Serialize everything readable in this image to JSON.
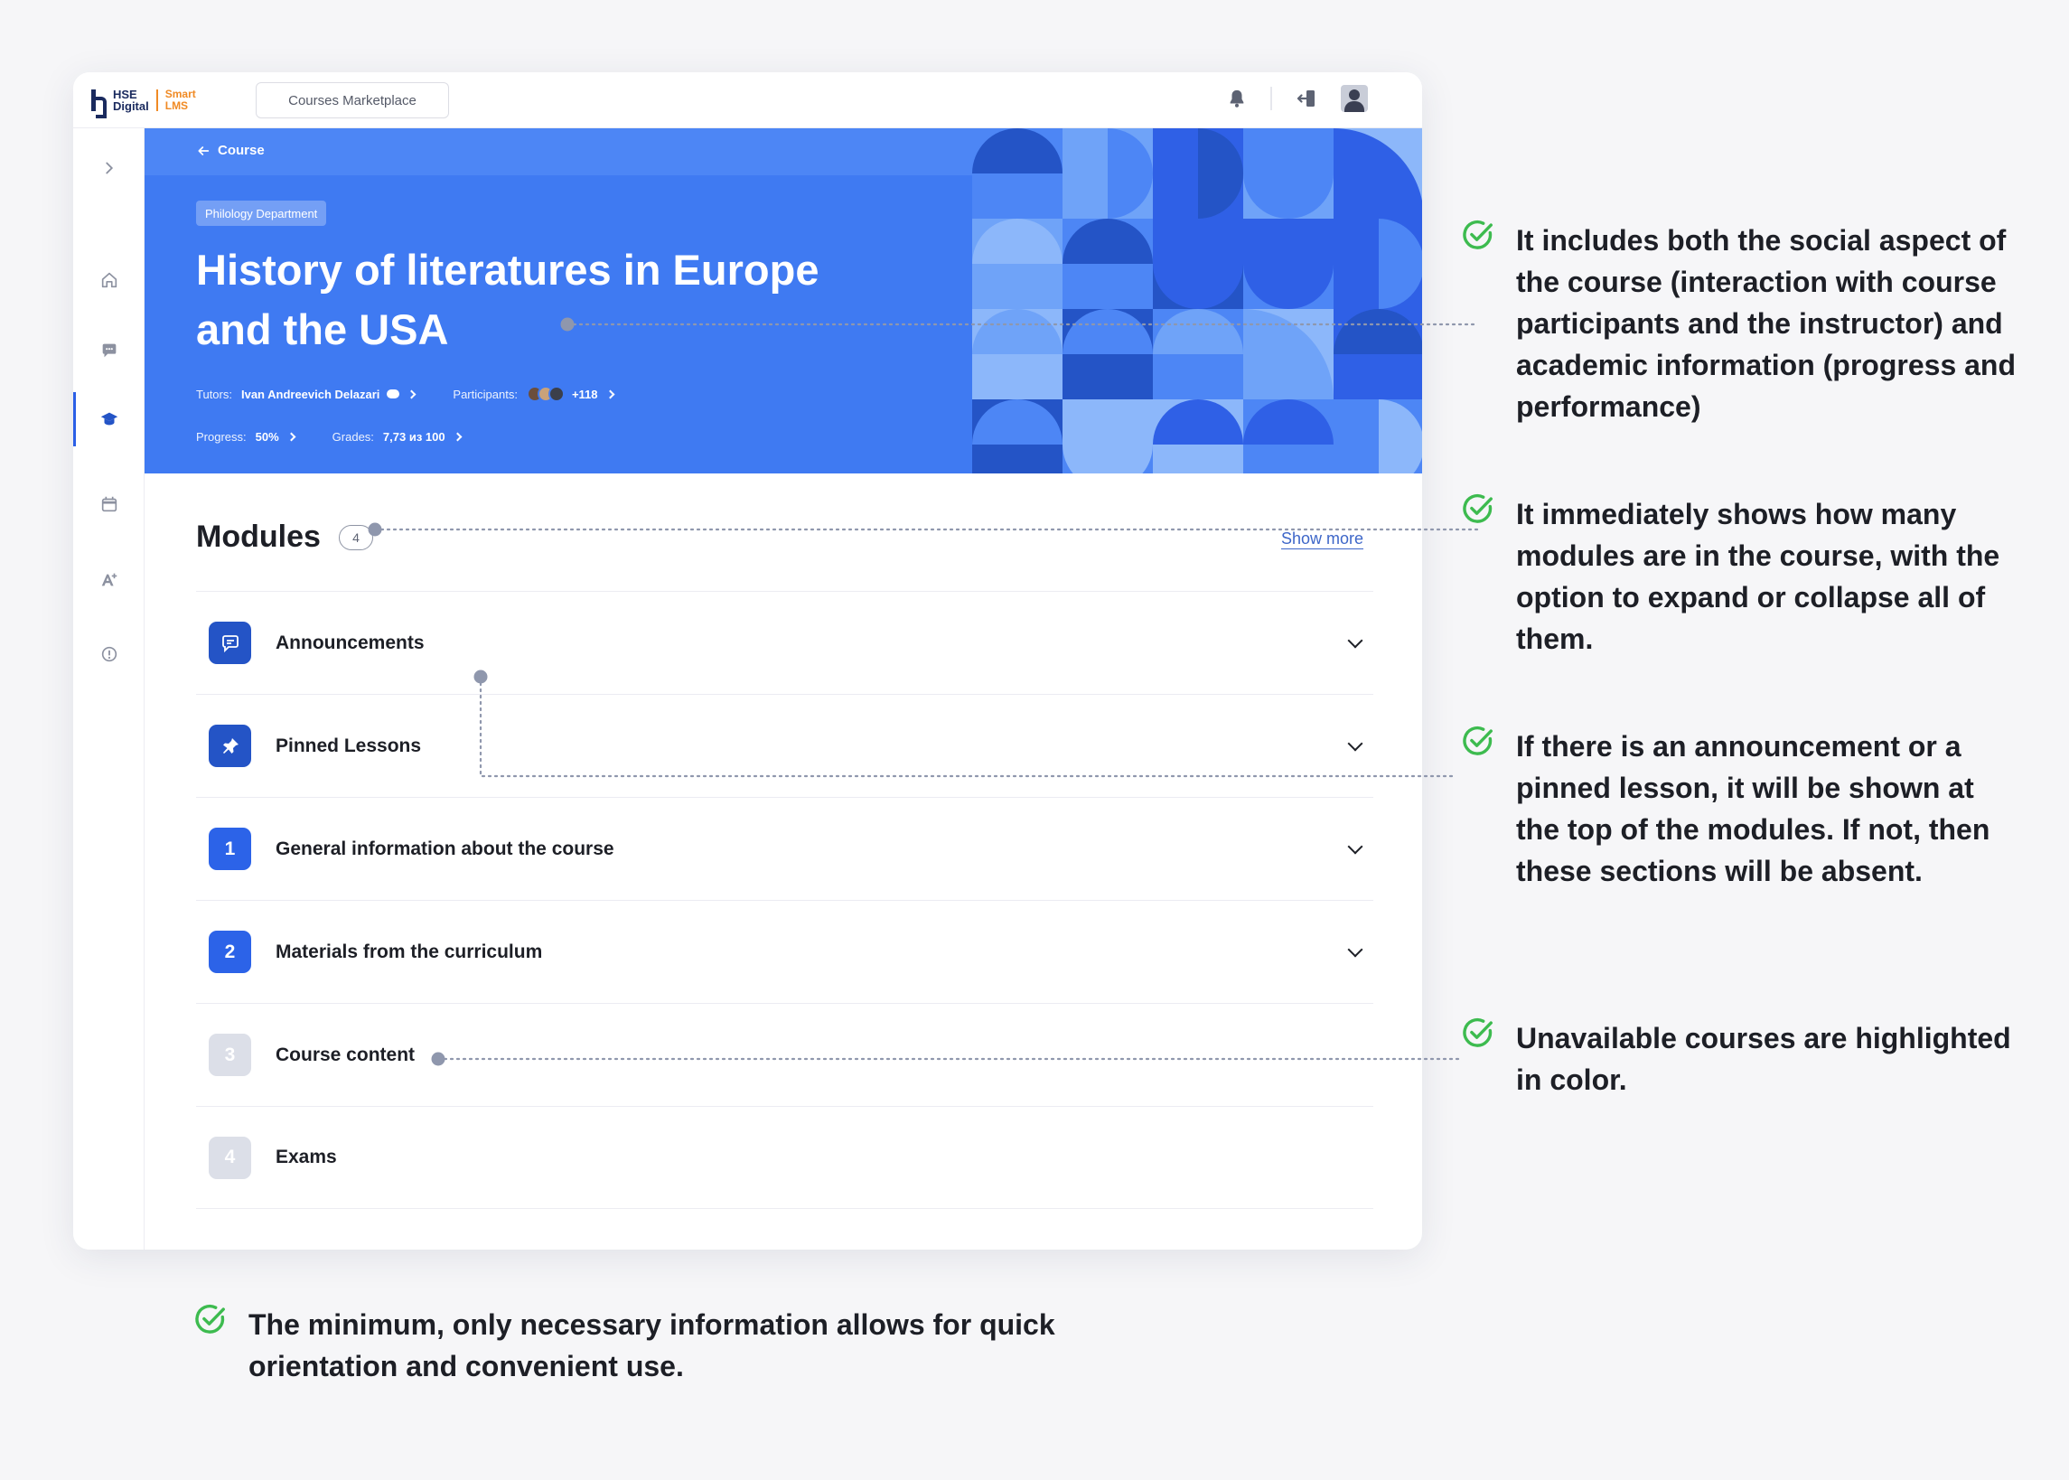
{
  "topbar": {
    "logo_line1": "HSE",
    "logo_line2": "Digital",
    "logo_smart1": "Smart",
    "logo_smart2": "LMS",
    "marketplace_label": "Courses Marketplace"
  },
  "hero": {
    "breadcrumb": "Course",
    "department": "Philology Department",
    "title": "History of literatures in Europe and the USA",
    "tutors_label": "Tutors:",
    "tutor_name": "Ivan Andreevich Delazari",
    "participants_label": "Participants:",
    "participants_extra": "+118",
    "progress_label": "Progress:",
    "progress_value": "50%",
    "grades_label": "Grades:",
    "grades_value": "7,73 из 100"
  },
  "modules": {
    "title": "Modules",
    "count": "4",
    "show_more": "Show more",
    "items": [
      {
        "label": "Announcements",
        "badge": "",
        "icon": "chat-icon"
      },
      {
        "label": "Pinned Lessons",
        "badge": "",
        "icon": "pin-icon"
      },
      {
        "label": "General information about the course",
        "badge": "1"
      },
      {
        "label": "Materials from the curriculum",
        "badge": "2"
      },
      {
        "label": "Course content",
        "badge": "3"
      },
      {
        "label": "Exams",
        "badge": "4"
      }
    ]
  },
  "callouts": [
    "It includes both the social aspect of the course (interaction with course participants and the instructor) and academic information (progress and performance)",
    "It immediately shows how many modules are in the course, with the option to expand or collapse all of them.",
    "If there is an announcement or a pinned lesson, it will be shown at the top of the modules. If not, then these sections will be absent.",
    "Unavailable courses are highlighted in color.",
    "The minimum, only necessary information allows for quick orientation and convenient use."
  ],
  "colors": {
    "accent": "#3f7af2",
    "check": "#3dbb4f",
    "disabled": "#dcdfe8"
  }
}
